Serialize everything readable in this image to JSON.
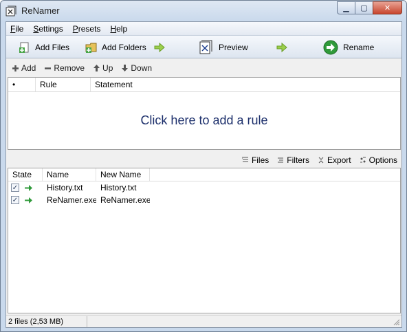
{
  "window": {
    "title": "ReNamer"
  },
  "menu": [
    {
      "label": "File"
    },
    {
      "label": "Settings"
    },
    {
      "label": "Presets"
    },
    {
      "label": "Help"
    }
  ],
  "toolbar": {
    "add_files": "Add Files",
    "add_folders": "Add Folders",
    "preview": "Preview",
    "rename": "Rename"
  },
  "rules_toolbar": {
    "add": "Add",
    "remove": "Remove",
    "up": "Up",
    "down": "Down"
  },
  "rules_table": {
    "columns": [
      "•",
      "Rule",
      "Statement"
    ],
    "placeholder": "Click here to add a rule"
  },
  "files_toolbar": {
    "files": "Files",
    "filters": "Filters",
    "export": "Export",
    "options": "Options"
  },
  "files_table": {
    "columns": [
      "State",
      "Name",
      "New Name"
    ],
    "rows": [
      {
        "name": "History.txt",
        "new_name": "History.txt",
        "checked": true
      },
      {
        "name": "ReNamer.exe",
        "new_name": "ReNamer.exe",
        "checked": true
      }
    ]
  },
  "status": {
    "summary": "2 files (2,53 MB)"
  },
  "colors": {
    "placeholder_text": "#1c2f6b",
    "arrow_green": "#2f9a3a",
    "rename_green": "#2f9a3a"
  }
}
